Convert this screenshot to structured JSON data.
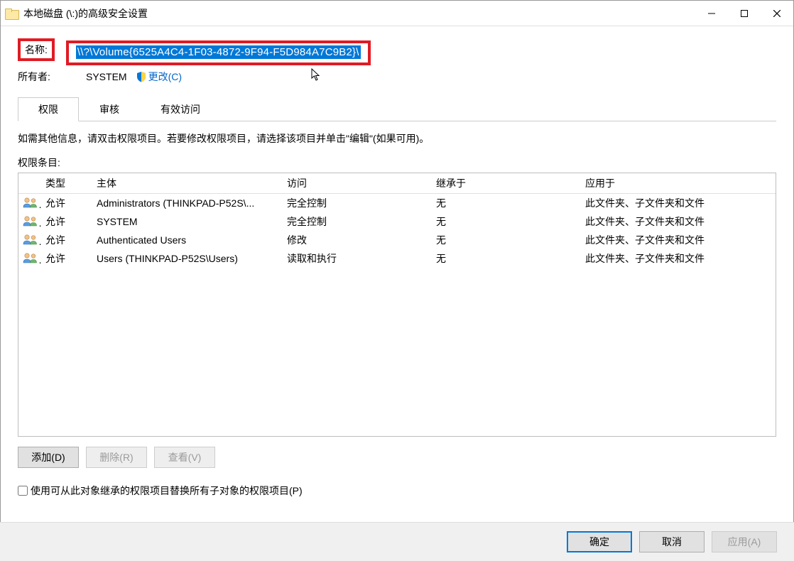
{
  "window": {
    "title": "本地磁盘 (\\:)的高级安全设置"
  },
  "labels": {
    "name": "名称:",
    "owner": "所有者:",
    "change": "更改(C)",
    "path": "\\\\?\\Volume{6525A4C4-1F03-4872-9F94-F5D984A7C9B2}\\",
    "owner_value": "SYSTEM",
    "help": "如需其他信息，请双击权限项目。若要修改权限项目，请选择该项目并单击\"编辑\"(如果可用)。",
    "entries": "权限条目:",
    "replace_checkbox": "使用可从此对象继承的权限项目替换所有子对象的权限项目(P)"
  },
  "tabs": [
    {
      "label": "权限",
      "active": true
    },
    {
      "label": "审核",
      "active": false
    },
    {
      "label": "有效访问",
      "active": false
    }
  ],
  "columns": {
    "type": "类型",
    "principal": "主体",
    "access": "访问",
    "inherited": "继承于",
    "applies": "应用于"
  },
  "rows": [
    {
      "type": "允许",
      "principal": "Administrators (THINKPAD-P52S\\...",
      "access": "完全控制",
      "inherited": "无",
      "applies": "此文件夹、子文件夹和文件"
    },
    {
      "type": "允许",
      "principal": "SYSTEM",
      "access": "完全控制",
      "inherited": "无",
      "applies": "此文件夹、子文件夹和文件"
    },
    {
      "type": "允许",
      "principal": "Authenticated Users",
      "access": "修改",
      "inherited": "无",
      "applies": "此文件夹、子文件夹和文件"
    },
    {
      "type": "允许",
      "principal": "Users (THINKPAD-P52S\\Users)",
      "access": "读取和执行",
      "inherited": "无",
      "applies": "此文件夹、子文件夹和文件"
    }
  ],
  "buttons": {
    "add": "添加(D)",
    "remove": "删除(R)",
    "view": "查看(V)",
    "ok": "确定",
    "cancel": "取消",
    "apply": "应用(A)"
  }
}
